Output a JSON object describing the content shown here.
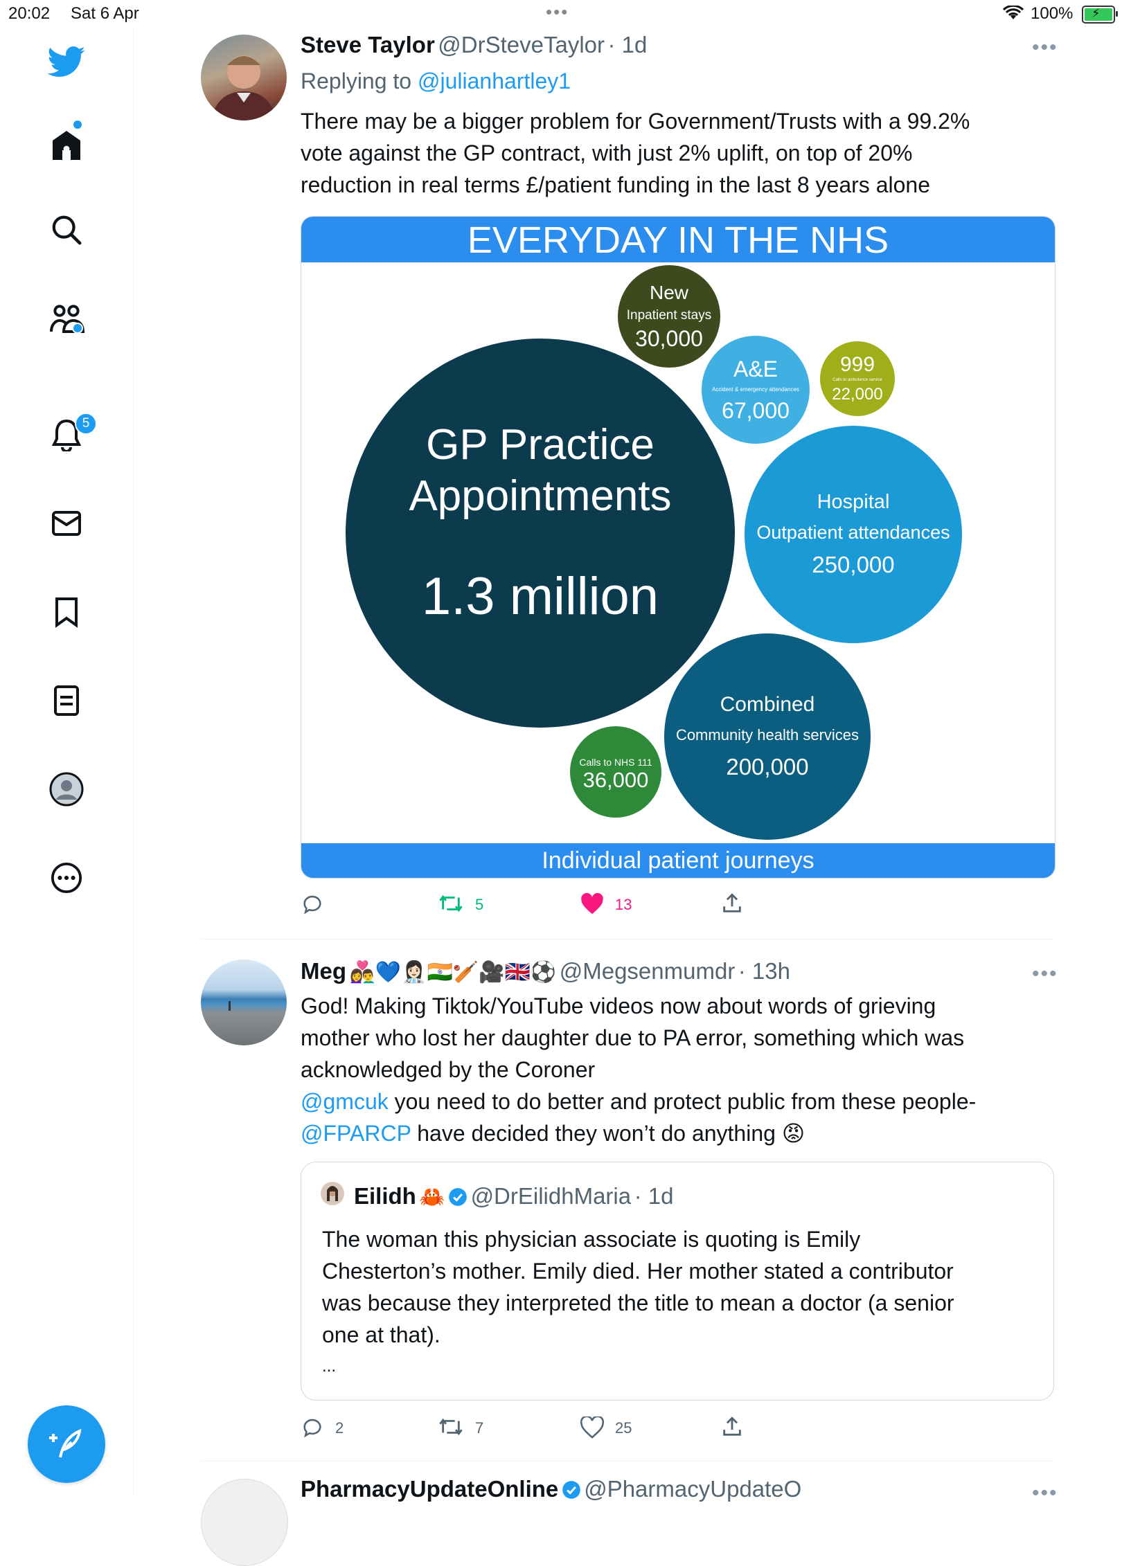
{
  "status_bar": {
    "time": "20:02",
    "date": "Sat 6 Apr",
    "battery": "100%"
  },
  "sidebar": {
    "notifications_badge": "5",
    "icons": [
      "twitter-logo-icon",
      "home-icon",
      "search-icon",
      "communities-icon",
      "notifications-icon",
      "messages-icon",
      "bookmarks-icon",
      "lists-icon",
      "profile-icon",
      "more-icon"
    ]
  },
  "tweets": [
    {
      "name": "Steve Taylor",
      "handle": "@DrSteveTaylor",
      "time": "· 1d",
      "replying_prefix": "Replying to ",
      "replying_to": "@julianhartley1",
      "lines": [
        "There may be a bigger problem for Government/Trusts with a 99.2%",
        "vote against the GP contract, with just 2% uplift, on top of 20%",
        "reduction in real terms £/patient funding in the last 8 years alone"
      ],
      "image": {
        "header": "EVERYDAY IN THE NHS",
        "footer": "Individual patient journeys",
        "bubbles": {
          "gp": {
            "title1": "GP Practice",
            "title2": "Appointments",
            "value": "1.3 million"
          },
          "inpatient": {
            "title": "New",
            "sub": "Inpatient stays",
            "value": "30,000"
          },
          "ae": {
            "title": "A&E",
            "sub": "Accident & emergency attendances",
            "value": "67,000"
          },
          "ambulance": {
            "title": "999",
            "sub": "Calls to ambulance service",
            "value": "22,000"
          },
          "outpatient": {
            "title": "Hospital",
            "sub": "Outpatient attendances",
            "value": "250,000"
          },
          "community": {
            "title": "Combined",
            "sub": "Community health services",
            "value": "200,000"
          },
          "nhs111": {
            "sub": "Calls to NHS 111",
            "value": "36,000"
          }
        }
      },
      "retweets": "5",
      "likes": "13"
    },
    {
      "name": "Meg",
      "name_emojis": "👩‍❤️‍👨💙👩🏻‍⚕️🇮🇳🏏🎥🇬🇧⚽",
      "handle": "@Megsenmumdr",
      "time": "· 13h",
      "line1": "God! Making Tiktok/YouTube videos now about words of grieving",
      "line2": "mother who lost her daughter due to PA error, something which was",
      "line3": "acknowledged by the Coroner",
      "mention1": "@gmcuk",
      "line4_rest": " you need to do better and protect public from these people-",
      "mention2": "@FPARCP",
      "line5_rest": " have decided they won’t do anything ",
      "angry_emoji": "😡",
      "quote": {
        "name": "Eilidh",
        "emoji": "🦀",
        "handle": "@DrEilidhMaria",
        "time": "· 1d",
        "lines": [
          "The woman this physician associate is quoting is Emily",
          "Chesterton’s mother. Emily died. Her mother stated a contributor",
          "was because they interpreted the title to mean a doctor (a senior",
          "one at that)."
        ],
        "ellipsis": "..."
      },
      "replies": "2",
      "retweets": "7",
      "likes": "25"
    },
    {
      "name": "PharmacyUpdateOnline",
      "handle": "@PharmacyUpdateO"
    }
  ]
}
